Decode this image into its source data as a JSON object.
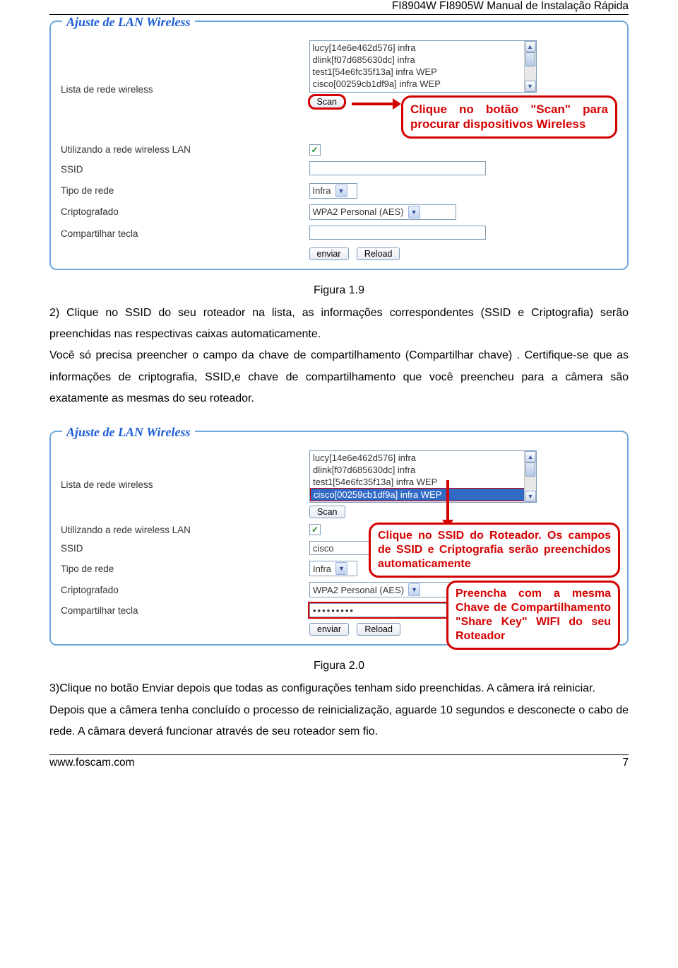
{
  "header_title": "FI8904W FI8905W Manual de Instalação Rápida",
  "fig1": {
    "legend": "Ajuste de LAN Wireless",
    "labels": {
      "wireless_list": "Lista de rede wireless",
      "use_wlan": "Utilizando a rede wireless LAN",
      "ssid": "SSID",
      "net_type": "Tipo de rede",
      "encrypt": "Criptografado",
      "share_key": "Compartilhar tecla"
    },
    "list_items": [
      "lucy[14e6e462d576] infra",
      "dlink[f07d685630dc] infra",
      "test1[54e6fc35f13a] infra WEP",
      "cisco[00259cb1df9a] infra WEP"
    ],
    "scan_btn": "Scan",
    "ssid_val": "",
    "net_type_val": "Infra",
    "encrypt_val": "WPA2 Personal (AES)",
    "share_key_val": "",
    "submit_btn": "enviar",
    "reload_btn": "Reload",
    "callout": "Clique no botão \"Scan\" para procurar dispositivos Wireless"
  },
  "fig1_caption": "Figura 1.9",
  "para1": "2) Clique no SSID do seu roteador na lista, as informações correspondentes (SSID e Criptografia) serão preenchidas nas respectivas caixas automaticamente.",
  "para2": "Você só precisa preencher o campo da chave de compartilhamento (Compartilhar chave) . Certifique-se que as informações de criptografia, SSID,e chave de compartilhamento que você preencheu para a câmera são exatamente as mesmas do seu roteador.",
  "fig2": {
    "legend": "Ajuste de LAN Wireless",
    "labels": {
      "wireless_list": "Lista de rede wireless",
      "use_wlan": "Utilizando a rede wireless LAN",
      "ssid": "SSID",
      "net_type": "Tipo de rede",
      "encrypt": "Criptografado",
      "share_key": "Compartilhar tecla"
    },
    "list_items": [
      "lucy[14e6e462d576] infra",
      "dlink[f07d685630dc] infra",
      "test1[54e6fc35f13a] infra WEP",
      "cisco[00259cb1df9a] infra WEP"
    ],
    "selected_index": "3",
    "scan_btn": "Scan",
    "ssid_val": "cisco",
    "net_type_val": "Infra",
    "encrypt_val": "WPA2 Personal (AES)",
    "share_key_val": "•••••••••",
    "submit_btn": "enviar",
    "reload_btn": "Reload",
    "callout1": "Clique no SSID do Roteador. Os campos de SSID e Criptografia serão preenchidos automaticamente",
    "callout2": "Preencha com a mesma Chave de Compartilhamento \"Share Key\" WIFI do seu Roteador"
  },
  "fig2_caption": "Figura 2.0",
  "para3": "3)Clique no botão Enviar depois que todas as configurações tenham sido preenchidas. A câmera irá reiniciar.",
  "para4": "Depois que a câmera tenha concluído o processo de reinicialização, aguarde 10 segundos e desconecte o cabo de rede. A câmara deverá funcionar através de seu roteador sem fio.",
  "footer_url": "www.foscam.com",
  "footer_page": "7"
}
